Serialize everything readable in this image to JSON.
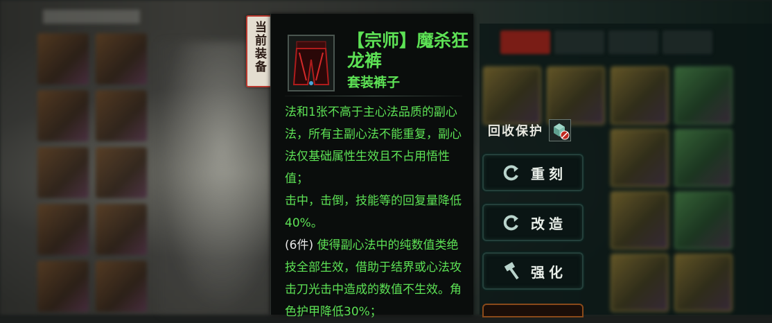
{
  "current_equipment_tab": {
    "label": "当前装备"
  },
  "tooltip": {
    "item_icon": "dark-red-pants-icon",
    "item_name": "【宗师】魔杀狂龙裤",
    "item_type": "套装裤子",
    "description": {
      "line1": "法和1张不高于主心法品质的副心法，所有主副心法不能重复，副心法仅基础属性生效且不占用悟性值；",
      "line2": "击中，击倒，技能等的回复量降低40%。",
      "set_label": "(6件)",
      "set_effect": " 使得副心法中的纯数值类绝技全部生效，借助于结界或心法攻击刀光击中造成的数值不生效。角色护甲降低30%；"
    }
  },
  "recycle_protection": {
    "label": "回收保护",
    "icon": "recycle-protect-icon"
  },
  "actions": {
    "reset": {
      "label": "重刻",
      "icon": "refresh-icon"
    },
    "modify": {
      "label": "改造",
      "icon": "refresh-icon"
    },
    "enhance": {
      "label": "强化",
      "icon": "hammer-icon"
    }
  },
  "colors": {
    "item_text": "#5de255",
    "tab_border": "#b9382e",
    "button_bg": "#0a1514"
  }
}
